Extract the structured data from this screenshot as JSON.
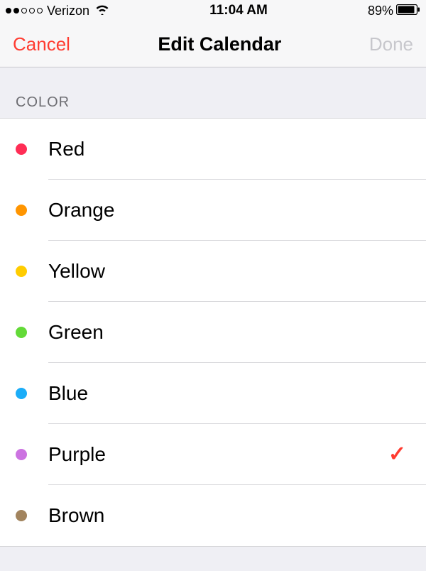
{
  "status_bar": {
    "carrier": "Verizon",
    "time": "11:04 AM",
    "battery_percent": "89%"
  },
  "nav": {
    "cancel_label": "Cancel",
    "title": "Edit Calendar",
    "done_label": "Done"
  },
  "section_header": "COLOR",
  "colors": [
    {
      "label": "Red",
      "hex": "#ff2d55",
      "selected": false
    },
    {
      "label": "Orange",
      "hex": "#ff9500",
      "selected": false
    },
    {
      "label": "Yellow",
      "hex": "#ffcc00",
      "selected": false
    },
    {
      "label": "Green",
      "hex": "#63da38",
      "selected": false
    },
    {
      "label": "Blue",
      "hex": "#1badf8",
      "selected": false
    },
    {
      "label": "Purple",
      "hex": "#cc73e1",
      "selected": true
    },
    {
      "label": "Brown",
      "hex": "#a2845e",
      "selected": false
    }
  ],
  "checkmark_glyph": "✓"
}
